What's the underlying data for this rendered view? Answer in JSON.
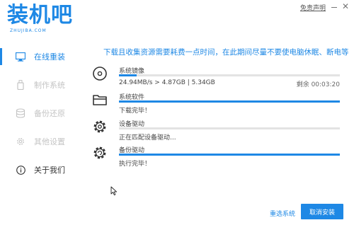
{
  "header": {
    "logo_text": "装机吧",
    "logo_sub": "ZHUJIBA.COM",
    "disclaimer": "免责声明"
  },
  "sidebar": {
    "items": [
      {
        "label": "在线重装",
        "icon": "monitor-icon",
        "state": "active"
      },
      {
        "label": "制作系统",
        "icon": "usb-icon",
        "state": "disabled"
      },
      {
        "label": "备份还原",
        "icon": "backup-icon",
        "state": "disabled"
      },
      {
        "label": "其他设置",
        "icon": "gear-icon",
        "state": "disabled"
      },
      {
        "label": "关于我们",
        "icon": "info-icon",
        "state": "normal"
      }
    ]
  },
  "main": {
    "notice": "下载且收集资源需要耗费一点时间，在此期间尽量不要使电脑休眠、断电等",
    "tasks": [
      {
        "name": "系统镜像",
        "icon": "disc-icon",
        "status": "24.94MB/s > 4.87GB | 5.34GB",
        "remaining": "剩余 00:03:20",
        "progress": 0.08
      },
      {
        "name": "系统软件",
        "icon": "folder-icon",
        "status": "下载完毕！",
        "remaining": "",
        "progress": 1.0
      },
      {
        "name": "设备驱动",
        "icon": "driver-gear-icon",
        "status": "正在匹配设备驱动...",
        "remaining": "",
        "progress": 0.0
      },
      {
        "name": "备份驱动",
        "icon": "backup-gear-icon",
        "status": "执行完毕！",
        "remaining": "",
        "progress": 1.0
      }
    ]
  },
  "footer": {
    "reselect_label": "重选系统",
    "cancel_label": "取消安装"
  },
  "colors": {
    "accent": "#1e88e5",
    "disabled": "#c4c4c4",
    "track": "#e3e3e3"
  }
}
